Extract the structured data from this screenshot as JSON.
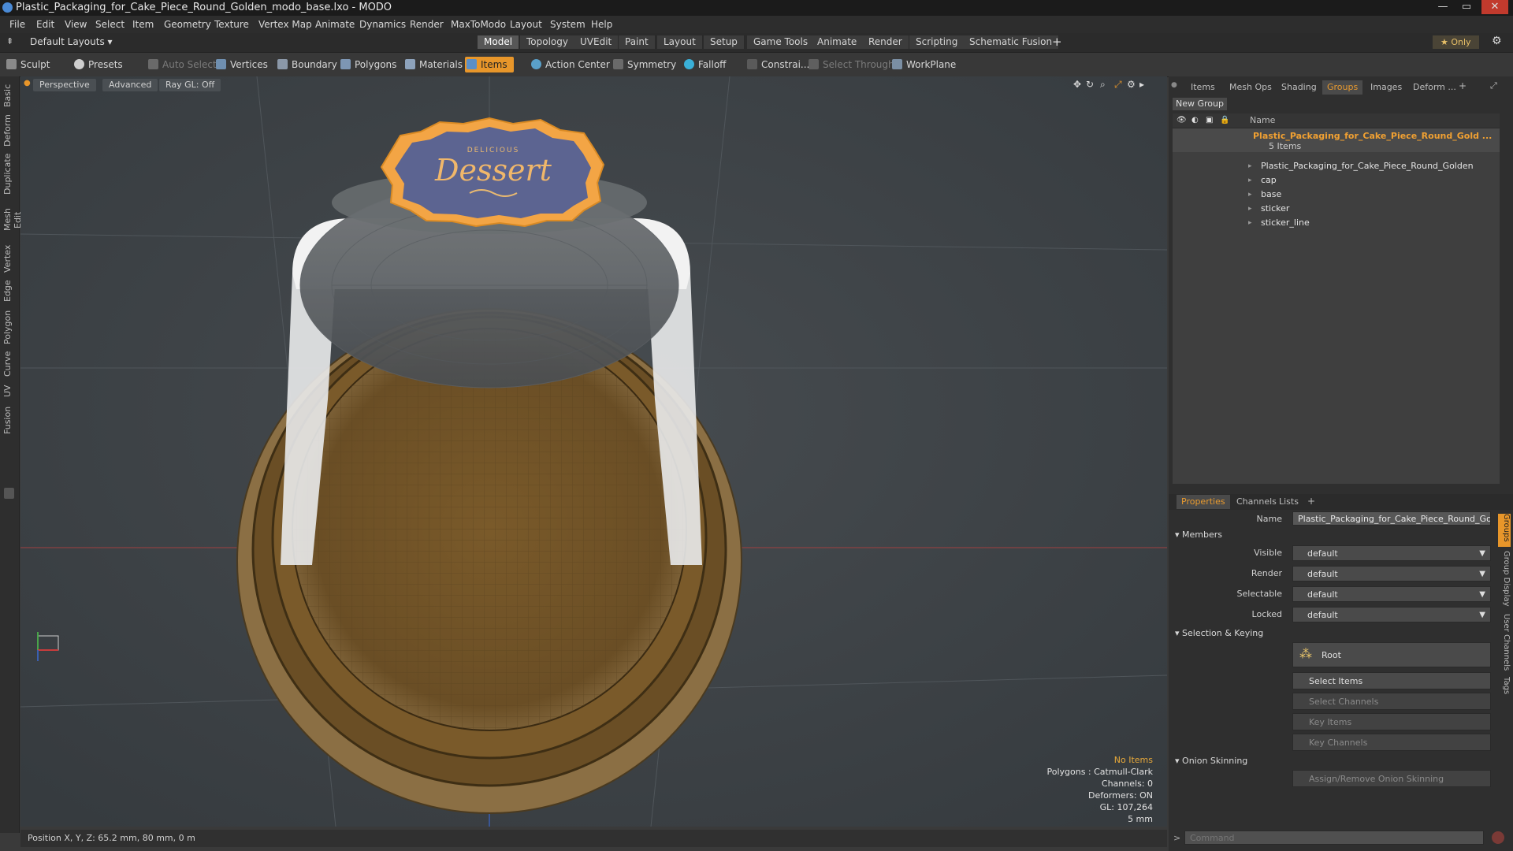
{
  "window": {
    "title": "Plastic_Packaging_for_Cake_Piece_Round_Golden_modo_base.lxo - MODO",
    "minimize": "—",
    "restore": "▭",
    "close": "✕"
  },
  "menu": [
    "File",
    "Edit",
    "View",
    "Select",
    "Item",
    "Geometry",
    "Texture",
    "Vertex Map",
    "Animate",
    "Dynamics",
    "Render",
    "MaxToModo",
    "Layout",
    "System",
    "Help"
  ],
  "layoutbar": {
    "layouts_label": "Default Layouts",
    "tabs": [
      "Model",
      "Topology",
      "UVEdit",
      "Paint",
      "Layout",
      "Setup",
      "Game Tools",
      "Animate",
      "Render",
      "Scripting",
      "Schematic Fusion"
    ],
    "active_tab": "Model",
    "add": "+",
    "only_label": "★  Only"
  },
  "toolbar": {
    "sculpt": "Sculpt",
    "presets": "Presets",
    "auto_select": "Auto Select",
    "vertices": "Vertices",
    "boundary": "Boundary",
    "polygons": "Polygons",
    "materials": "Materials",
    "items": "Items",
    "action_center": "Action Center",
    "symmetry": "Symmetry",
    "falloff": "Falloff",
    "constraints": "Constrai...",
    "select_through": "Select Through",
    "workplane": "WorkPlane"
  },
  "left_tabs": [
    "Basic",
    "Deform",
    "Duplicate",
    "Mesh Edit",
    "Vertex",
    "Edge",
    "Polygon",
    "Curve",
    "UV",
    "Fusion"
  ],
  "viewport": {
    "view_mode": "Perspective",
    "shading": "Advanced",
    "raygl": "Ray GL: Off",
    "sticker_small": "DELICIOUS",
    "sticker_main": "Dessert",
    "stats": [
      "No Items",
      "Polygons : Catmull-Clark",
      "Channels: 0",
      "Deformers: ON",
      "GL: 107,264",
      "5 mm"
    ],
    "status": "Position X, Y, Z:   65.2 mm, 80 mm, 0 m"
  },
  "right_tabs": [
    "Items",
    "Mesh Ops",
    "Shading",
    "Groups",
    "Images",
    "Deform ..."
  ],
  "right_active": "Groups",
  "groups": {
    "new_group": "New Group",
    "name_header": "Name",
    "root_name": "Plastic_Packaging_for_Cake_Piece_Round_Gold ...",
    "count": "5 Items",
    "children": [
      "Plastic_Packaging_for_Cake_Piece_Round_Golden",
      "cap",
      "base",
      "sticker",
      "sticker_line"
    ]
  },
  "props_tabs": [
    "Properties",
    "Channels",
    "Lists"
  ],
  "props": {
    "name_label": "Name",
    "name_value": "Plastic_Packaging_for_Cake_Piece_Round_Golden",
    "members_section": "Members",
    "rows": [
      {
        "label": "Visible",
        "value": "default"
      },
      {
        "label": "Render",
        "value": "default"
      },
      {
        "label": "Selectable",
        "value": "default"
      },
      {
        "label": "Locked",
        "value": "default"
      }
    ],
    "sel_section": "Selection & Keying",
    "root_btn": "Root",
    "select_items": "Select Items",
    "select_channels": "Select Channels",
    "key_items": "Key Items",
    "key_channels": "Key Channels",
    "onion_section": "Onion Skinning",
    "onion_btn": "Assign/Remove Onion Skinning"
  },
  "side_tabs": [
    "Groups",
    "Group Display",
    "User Channels",
    "Tags"
  ],
  "command_placeholder": "Command",
  "colors": {
    "accent": "#e8962a",
    "bg": "#3e4347"
  }
}
